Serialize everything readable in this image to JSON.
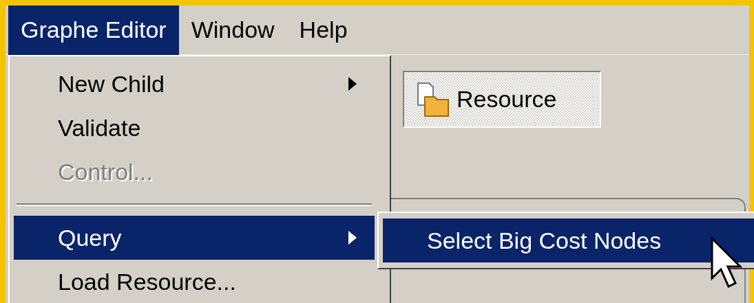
{
  "menubar": [
    {
      "label": "Graphe Editor",
      "selected": true
    },
    {
      "label": "Window",
      "selected": false
    },
    {
      "label": "Help",
      "selected": false
    }
  ],
  "toolbar": {
    "button": {
      "label": "Resource",
      "pressed": true
    }
  },
  "menu": {
    "items": [
      {
        "kind": "item",
        "label": "New Child",
        "submenu": true,
        "disabled": false,
        "selected": false
      },
      {
        "kind": "item",
        "label": "Validate",
        "submenu": false,
        "disabled": false,
        "selected": false
      },
      {
        "kind": "item",
        "label": "Control...",
        "submenu": false,
        "disabled": true,
        "selected": false
      },
      {
        "kind": "separator"
      },
      {
        "kind": "item",
        "label": "Query",
        "submenu": true,
        "disabled": false,
        "selected": true
      },
      {
        "kind": "item",
        "label": "Load Resource...",
        "submenu": false,
        "disabled": false,
        "selected": false
      }
    ]
  },
  "submenu": {
    "items": [
      {
        "label": "Select Big Cost Nodes",
        "selected": true
      }
    ]
  }
}
